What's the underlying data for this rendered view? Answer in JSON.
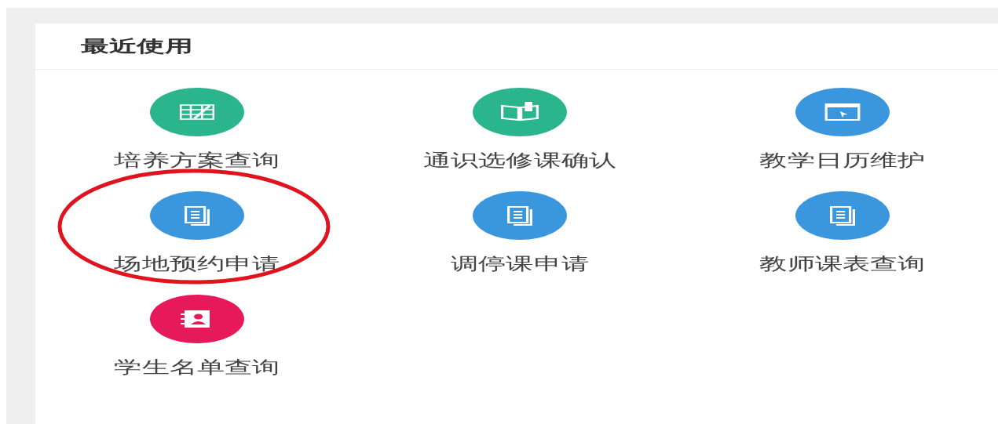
{
  "panel": {
    "title": "最近使用"
  },
  "items": [
    {
      "label": "培养方案查询",
      "kind": "table",
      "color": "#2bb58d",
      "highlighted": false
    },
    {
      "label": "通识选修课确认",
      "kind": "book",
      "color": "#2bb58d",
      "highlighted": false
    },
    {
      "label": "教学日历维护",
      "kind": "window",
      "color": "#3a96dd",
      "highlighted": false
    },
    {
      "label": "场地预约申请",
      "kind": "document",
      "color": "#3a96dd",
      "highlighted": true
    },
    {
      "label": "调停课申请",
      "kind": "document",
      "color": "#3a96dd",
      "highlighted": false
    },
    {
      "label": "教师课表查询",
      "kind": "document",
      "color": "#3a96dd",
      "highlighted": false
    },
    {
      "label": "学生名单查询",
      "kind": "contact",
      "color": "#e6195a",
      "highlighted": false
    }
  ]
}
